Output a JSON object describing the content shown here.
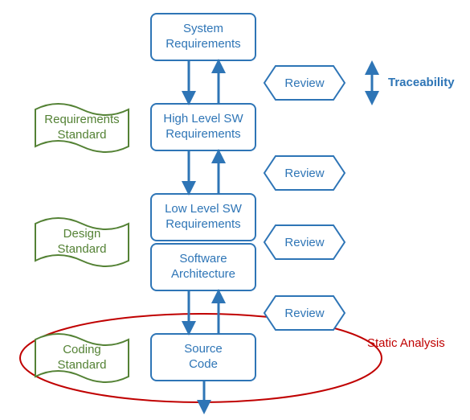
{
  "processes": {
    "system_req": "System\nRequirements",
    "hlsr": "High Level SW\nRequirements",
    "llsr": "Low Level SW\nRequirements",
    "arch": "Software\nArchitecture",
    "source": "Source\nCode"
  },
  "reviews": {
    "r1": "Review",
    "r2": "Review",
    "r3": "Review",
    "r4": "Review"
  },
  "standards": {
    "req": "Requirements\nStandard",
    "design": "Design\nStandard",
    "coding": "Coding\nStandard"
  },
  "labels": {
    "traceability": "Traceability",
    "static_analysis": "Static Analysis"
  },
  "colors": {
    "blue": "#2E75B6",
    "green": "#548235",
    "red": "#C00000"
  }
}
